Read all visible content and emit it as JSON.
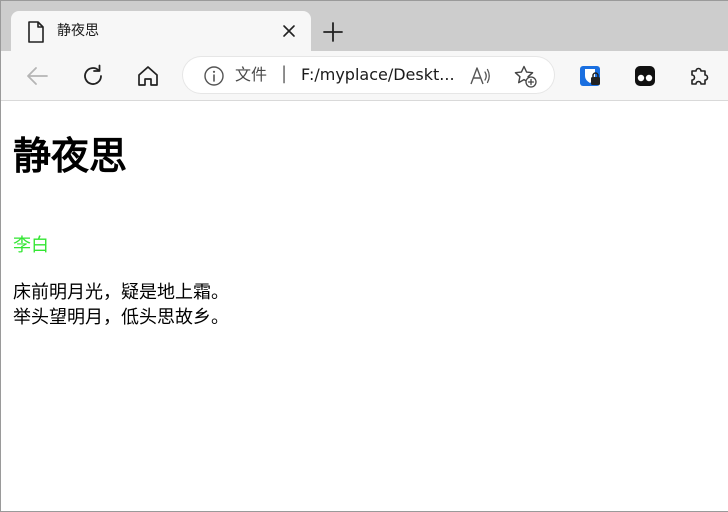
{
  "browser": {
    "tab": {
      "title": "静夜思",
      "icon": "document-icon",
      "close_icon": "close-icon"
    },
    "new_tab_icon": "plus-icon",
    "toolbar": {
      "back_icon": "back-arrow-icon",
      "refresh_icon": "refresh-icon",
      "home_icon": "home-icon",
      "extension_icons": [
        "password-manager-icon",
        "tampermonkey-icon",
        "puzzle-extensions-icon"
      ]
    },
    "address_bar": {
      "info_icon": "info-icon",
      "protocol_label": "文件",
      "separator": "|",
      "url": "F:/myplace/Deskt...",
      "read_aloud_icon": "read-aloud-icon",
      "favorites_icon": "add-favorite-icon"
    }
  },
  "page": {
    "heading": "静夜思",
    "author": "李白",
    "poem_lines": [
      "床前明月光，疑是地上霜。",
      "举头望明月，低头思故乡。"
    ]
  },
  "colors": {
    "author_text": "#33e633",
    "tab_strip_bg": "#cdcdcd",
    "toolbar_bg": "#f7f7f7",
    "accent_blue": "#1a6fe0"
  }
}
